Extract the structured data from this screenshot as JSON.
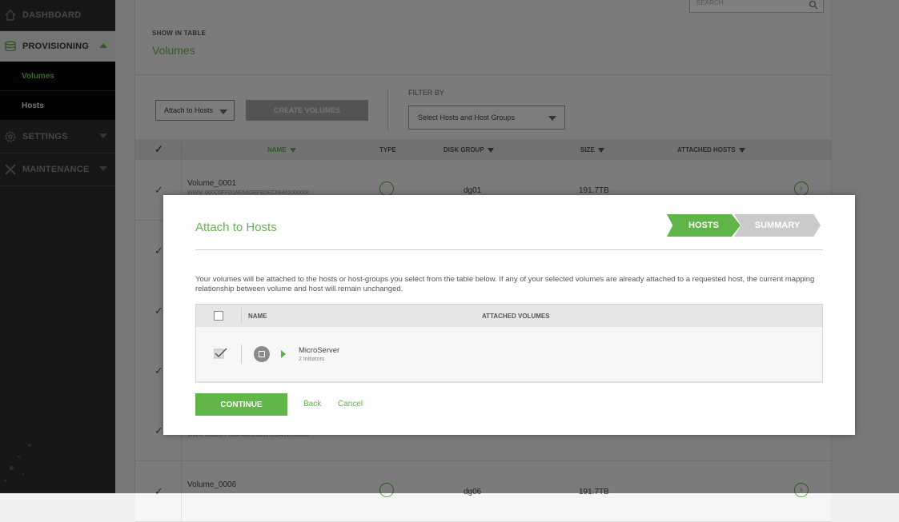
{
  "sidebar": {
    "dashboard": "DASHBOARD",
    "provisioning": "PROVISIONING",
    "sub_items": [
      "Volumes",
      "Hosts"
    ],
    "settings": "SETTINGS",
    "maintenance": "MAINTENANCE"
  },
  "main": {
    "top_search": "SEARCH",
    "show_in_table": "SHOW IN TABLE",
    "table_title": "Volumes",
    "attach_button": "Attach to Hosts",
    "create_button": "CREATE VOLUMES",
    "filter_label": "FILTER BY",
    "filter_placeholder": "Select Hosts and Host Groups",
    "columns": {
      "name": "NAME",
      "type": "TYPE",
      "disk_group": "DISK GROUP",
      "size": "SIZE",
      "attached_hosts": "ATTACHED HOSTS"
    },
    "rows": [
      {
        "name": "Volume_0001",
        "wwn": "WWN: 600C0FF00AE5ADEF8DEC68401000000",
        "disk_group": "dg01",
        "size": "191.7TB"
      },
      {
        "name": "",
        "wwn": "WWN: 600C0FF000F4AEC8C1EC58401000000",
        "disk_group": "",
        "size": ""
      },
      {
        "name": "Volume_0006",
        "wwn": "",
        "disk_group": "dg06",
        "size": "191.7TB"
      }
    ]
  },
  "modal": {
    "title": "Attach to Hosts",
    "steps": [
      "HOSTS",
      "SUMMARY"
    ],
    "description": "Your volumes will be attached to the hosts or host-groups you select from the table below. If any of your selected volumes are already attached to a requested host, the current mapping relationship between volume and host will remain unchanged.",
    "table_columns": {
      "name": "NAME",
      "attached_volumes": "ATTACHED VOLUMES"
    },
    "host": {
      "name": "MicroServer",
      "initiators": "2 Initiators"
    },
    "continue": "CONTINUE",
    "back": "Back",
    "cancel": "Cancel"
  },
  "colors": {
    "accent": "#5cb445",
    "sidebar_bg": "#2e2e2e",
    "disabled": "#a6a6a6"
  }
}
